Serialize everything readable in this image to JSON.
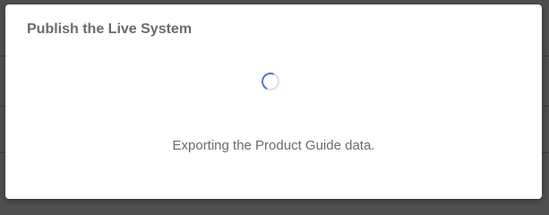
{
  "dialog": {
    "title": "Publish the Live System",
    "status_message": "Exporting the Product Guide data."
  },
  "colors": {
    "overlay": "#4f4f4f",
    "dialog_background": "#ffffff",
    "title_text": "#6b6b6b",
    "body_text": "#6a6a6a",
    "spinner_accent": "#5b6fc7"
  },
  "icons": {
    "spinner": "loading-spinner-icon"
  }
}
